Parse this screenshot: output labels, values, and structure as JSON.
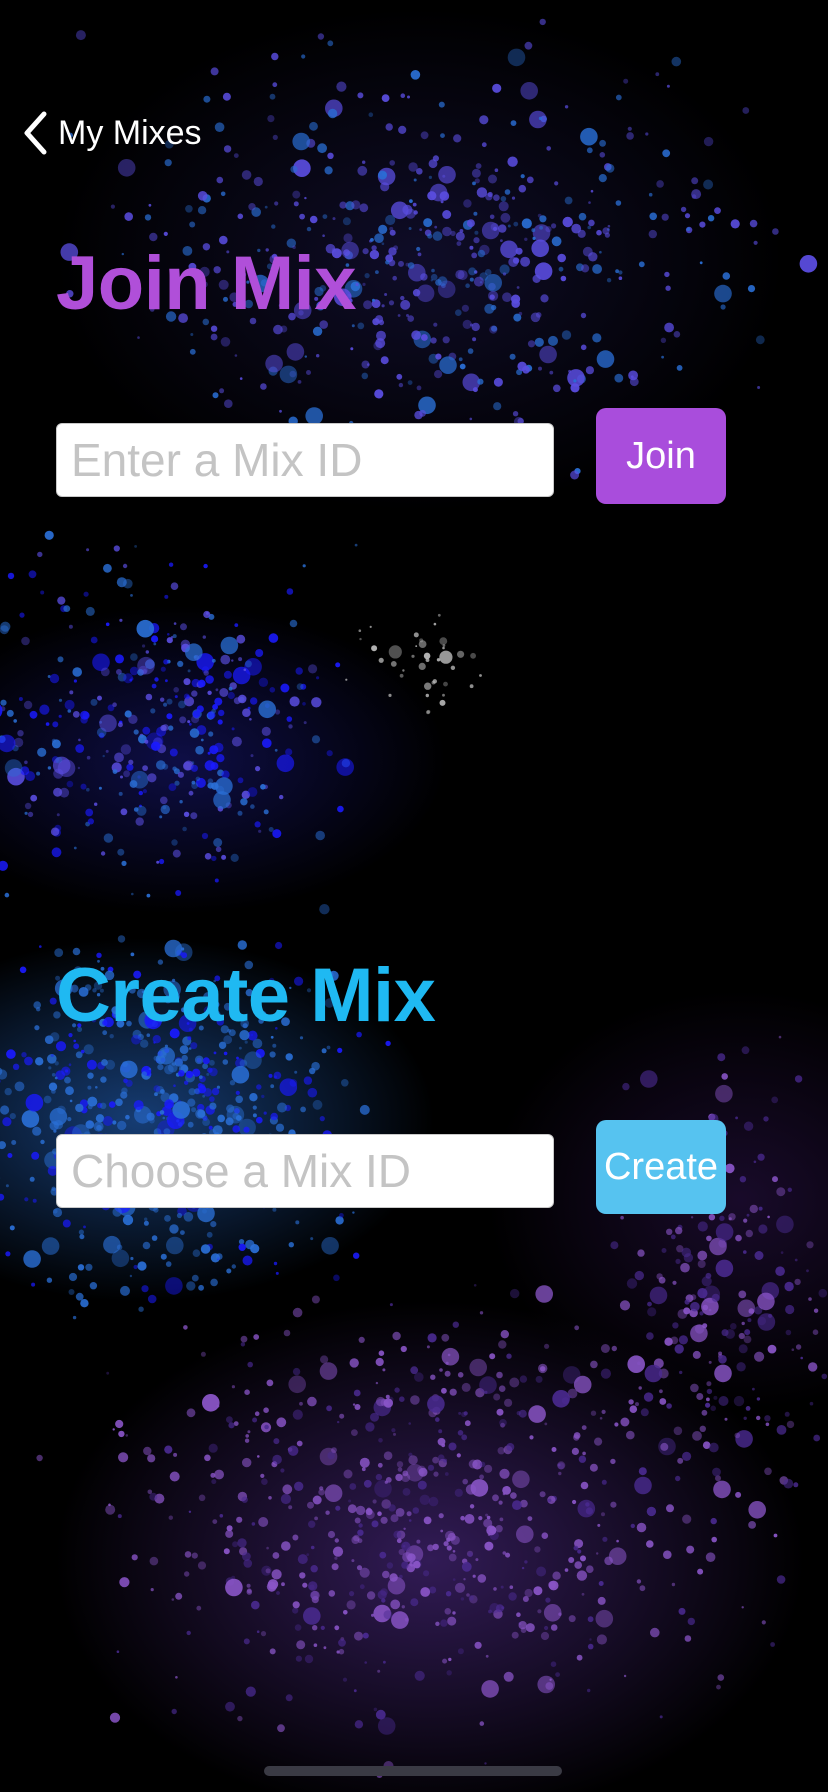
{
  "nav": {
    "back_label": "My Mixes",
    "back_icon": "chevron-left-icon"
  },
  "join": {
    "title": "Join Mix",
    "placeholder": "Enter a Mix ID",
    "value": "",
    "button_label": "Join",
    "accent": "#b04fd9",
    "button_color": "#a94ddc"
  },
  "create": {
    "title": "Create Mix",
    "placeholder": "Choose a Mix ID",
    "value": "",
    "button_label": "Create",
    "accent": "#1fb9f2",
    "button_color": "#56c3f0"
  },
  "background": {
    "style": "paint-splatter",
    "colors": [
      "#5a4de0",
      "#2a6fd6",
      "#1a1aff",
      "#8a55c8",
      "#4a2a90",
      "#bfbfbf"
    ]
  }
}
